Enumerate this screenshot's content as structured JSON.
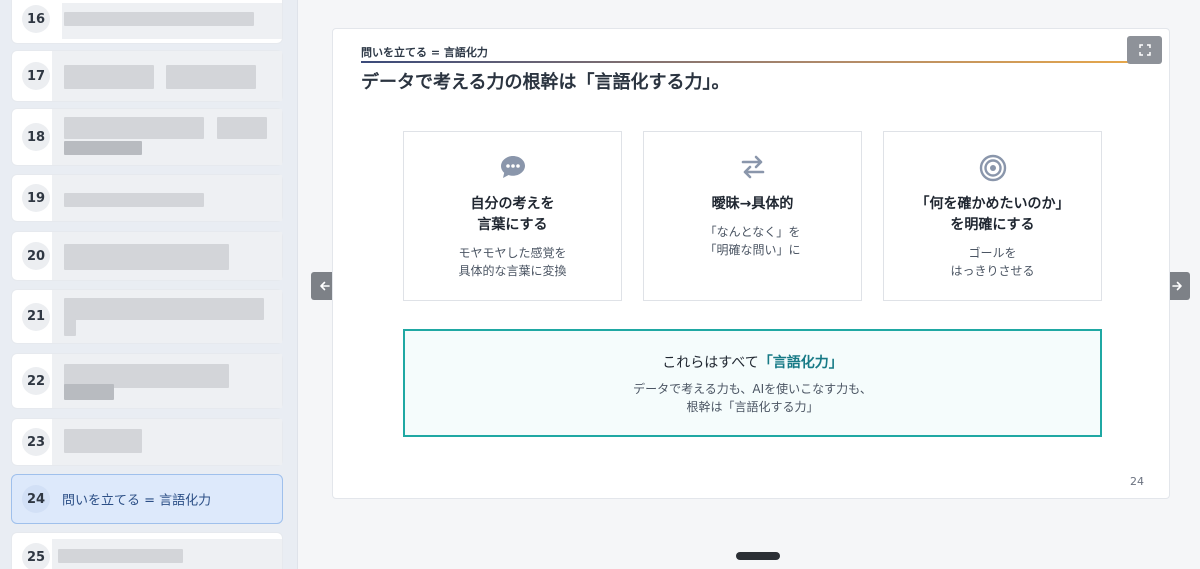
{
  "sidebar": {
    "items": [
      {
        "number": "16",
        "title": ""
      },
      {
        "number": "17",
        "title": ""
      },
      {
        "number": "18",
        "title": ""
      },
      {
        "number": "19",
        "title": ""
      },
      {
        "number": "20",
        "title": ""
      },
      {
        "number": "21",
        "title": ""
      },
      {
        "number": "22",
        "title": ""
      },
      {
        "number": "23",
        "title": ""
      },
      {
        "number": "24",
        "title": "問いを立てる = 言語化力",
        "active": true
      },
      {
        "number": "25",
        "title": ""
      }
    ]
  },
  "slide": {
    "kicker": "問いを立てる = 言語化力",
    "headline": "データで考える力の根幹は「言語化する力」。",
    "cards": [
      {
        "icon": "speech-bubble-icon",
        "title_line1": "自分の考えを",
        "title_line2": "言葉にする",
        "sub_line1": "モヤモヤした感覚を",
        "sub_line2": "具体的な言葉に変換"
      },
      {
        "icon": "swap-arrows-icon",
        "title_line1": "曖昧→具体的",
        "title_line2": "",
        "sub_line1": "「なんとなく」を",
        "sub_line2": "「明確な問い」に"
      },
      {
        "icon": "target-icon",
        "title_line1": "「何を確かめたいのか」",
        "title_line2": "を明確にする",
        "sub_line1": "ゴールを",
        "sub_line2": "はっきりさせる"
      }
    ],
    "summary": {
      "lead": "これらはすべて",
      "accent": "「言語化力」",
      "body_line1": "データで考える力も、AIを使いこなす力も、",
      "body_line2": "根幹は「言語化する力」"
    },
    "page_number": "24"
  },
  "colors": {
    "accent_teal": "#1fa8a3",
    "accent_text": "#177a86",
    "active_item_bg": "#dde9fb"
  }
}
